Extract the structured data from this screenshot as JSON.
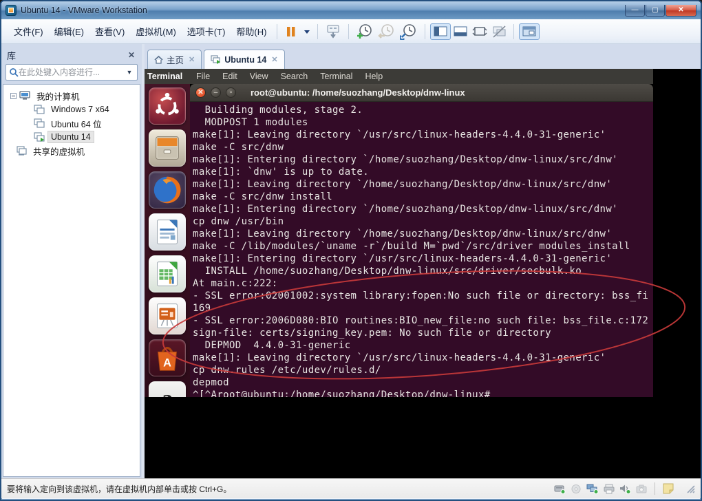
{
  "window": {
    "title": "Ubuntu 14 - VMware Workstation"
  },
  "menubar": {
    "items": [
      "文件(F)",
      "编辑(E)",
      "查看(V)",
      "虚拟机(M)",
      "选项卡(T)",
      "帮助(H)"
    ]
  },
  "toolbar": {
    "buttons": [
      "pause",
      "send-ctrl-alt-del",
      "take-snapshot",
      "revert-snapshot",
      "snapshot-manager",
      "show-console-view",
      "console-view",
      "fullscreen",
      "unity-mode",
      "show-library"
    ]
  },
  "tabs": {
    "home": {
      "label": "主页"
    },
    "vm": {
      "label": "Ubuntu 14"
    }
  },
  "sidebar": {
    "title": "库",
    "search_placeholder": "在此处键入内容进行...",
    "tree": {
      "computer": "我的计算机",
      "win7": "Windows 7 x64",
      "ubuntu64": "Ubuntu 64 位",
      "ubuntu14": "Ubuntu 14",
      "shared": "共享的虚拟机"
    }
  },
  "vm_screen": {
    "menubar": {
      "app": "Terminal",
      "items": [
        "File",
        "Edit",
        "View",
        "Search",
        "Terminal",
        "Help"
      ]
    },
    "launcher_icons": [
      "ubuntu-dash",
      "files",
      "firefox",
      "libreoffice-writer",
      "libreoffice-calc",
      "libreoffice-impress",
      "ubuntu-software-center",
      "amazon"
    ],
    "terminal": {
      "title": "root@ubuntu: /home/suozhang/Desktop/dnw-linux",
      "lines": [
        "  Building modules, stage 2.",
        "  MODPOST 1 modules",
        "make[1]: Leaving directory `/usr/src/linux-headers-4.4.0-31-generic'",
        "make -C src/dnw",
        "make[1]: Entering directory `/home/suozhang/Desktop/dnw-linux/src/dnw'",
        "make[1]: `dnw' is up to date.",
        "make[1]: Leaving directory `/home/suozhang/Desktop/dnw-linux/src/dnw'",
        "make -C src/dnw install",
        "make[1]: Entering directory `/home/suozhang/Desktop/dnw-linux/src/dnw'",
        "cp dnw /usr/bin",
        "make[1]: Leaving directory `/home/suozhang/Desktop/dnw-linux/src/dnw'",
        "make -C /lib/modules/`uname -r`/build M=`pwd`/src/driver modules_install",
        "make[1]: Entering directory `/usr/src/linux-headers-4.4.0-31-generic'",
        "  INSTALL /home/suozhang/Desktop/dnw-linux/src/driver/secbulk.ko",
        "At main.c:222:",
        "- SSL error:02001002:system library:fopen:No such file or directory: bss_fi",
        "169",
        "- SSL error:2006D080:BIO routines:BIO_new_file:no such file: bss_file.c:172",
        "sign-file: certs/signing_key.pem: No such file or directory",
        "  DEPMOD  4.4.0-31-generic",
        "make[1]: Leaving directory `/usr/src/linux-headers-4.4.0-31-generic'",
        "cp dnw.rules /etc/udev/rules.d/",
        "depmod",
        "^[^Aroot@ubuntu:/home/suozhang/Desktop/dnw-linux#"
      ]
    }
  },
  "statusbar": {
    "message": "要将输入定向到该虚拟机，请在虚拟机内部单击或按 Ctrl+G。"
  },
  "colors": {
    "annotation_red": "#c53a3a",
    "terminal_bg": "#330b27",
    "unity_bar": "#3c3b37",
    "titlebar_blue": "#5f86b0"
  }
}
